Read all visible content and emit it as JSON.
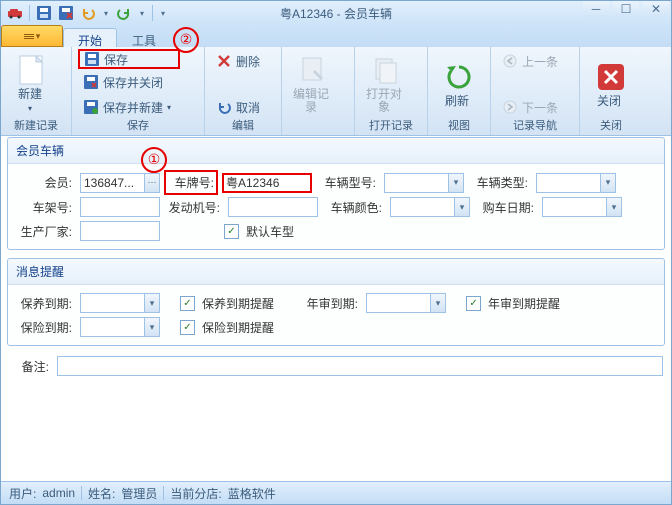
{
  "window": {
    "title": "粤A12346 - 会员车辆"
  },
  "qat": {
    "items": [
      "car",
      "save",
      "close-doc",
      "undo",
      "redo"
    ]
  },
  "tabs": {
    "start": "开始",
    "tools": "工具"
  },
  "ribbon": {
    "new_record_group": "新建记录",
    "new_btn": "新建",
    "save_group": "保存",
    "save": "保存",
    "save_close": "保存并关闭",
    "save_new": "保存并新建",
    "edit_group": "编辑",
    "delete": "删除",
    "cancel": "取消",
    "edit_record": "编辑记录",
    "open_record_group": "打开记录",
    "open_obj": "打开对象",
    "view_group": "视图",
    "refresh": "刷新",
    "nav_group": "记录导航",
    "prev": "上一条",
    "next": "下一条",
    "close_group": "关闭",
    "close": "关闭"
  },
  "annot": {
    "one": "①",
    "two": "②"
  },
  "panel1": {
    "title": "会员车辆",
    "member_lbl": "会员:",
    "member_val": "136847...",
    "plate_lbl": "车牌号:",
    "plate_val": "粤A12346",
    "model_lbl": "车辆型号:",
    "type_lbl": "车辆类型:",
    "vin_lbl": "车架号:",
    "engine_lbl": "发动机号:",
    "color_lbl": "车辆颜色:",
    "buy_date_lbl": "购车日期:",
    "mfr_lbl": "生产厂家:",
    "default_model_chk": true,
    "default_model_lbl": "默认车型"
  },
  "panel2": {
    "title": "消息提醒",
    "care_due_lbl": "保养到期:",
    "care_chk": true,
    "care_chk_lbl": "保养到期提醒",
    "audit_due_lbl": "年审到期:",
    "audit_chk": true,
    "audit_chk_lbl": "年审到期提醒",
    "ins_due_lbl": "保险到期:",
    "ins_chk": true,
    "ins_chk_lbl": "保险到期提醒"
  },
  "remark_lbl": "备注:",
  "status": {
    "user_lbl": "用户:",
    "user_val": "admin",
    "name_lbl": "姓名:",
    "name_val": "管理员",
    "store_lbl": "当前分店:",
    "store_val": "蓝格软件"
  }
}
